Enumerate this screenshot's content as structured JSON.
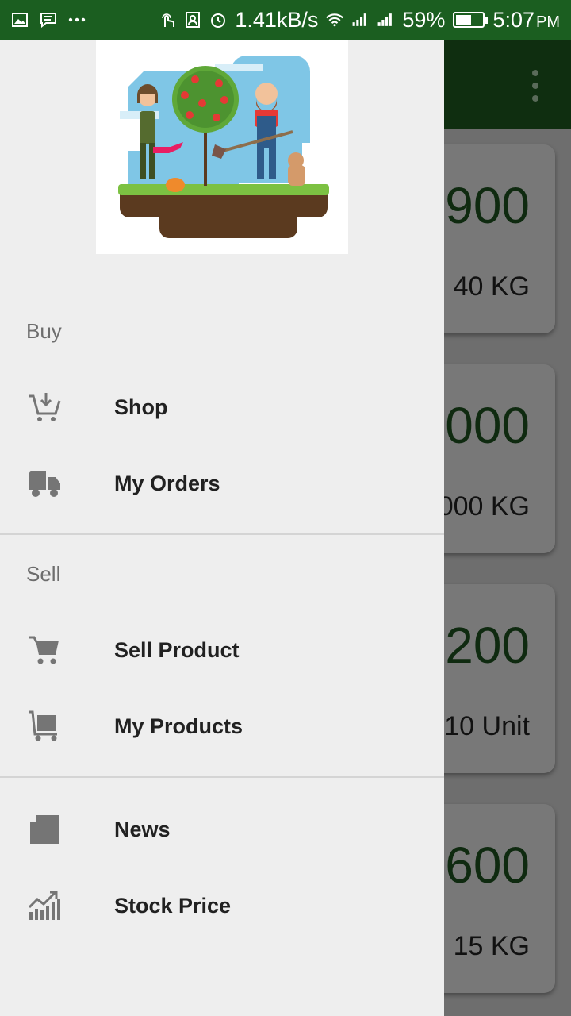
{
  "status_bar": {
    "speed": "1.41kB/s",
    "battery": "59%",
    "battery_level": 0.59,
    "time": "5:07",
    "time_suffix": "PM",
    "icons": [
      "image-icon",
      "message-icon",
      "more-icon",
      "touch-icon",
      "location-icon",
      "alarm-icon",
      "wifi-icon",
      "signal-icon",
      "battery-icon"
    ]
  },
  "drawer": {
    "header_image": "farmers-illustration",
    "sections": [
      {
        "title": "Buy",
        "items": [
          {
            "label": "Shop",
            "icon": "cart-download-icon"
          },
          {
            "label": "My Orders",
            "icon": "truck-icon"
          }
        ]
      },
      {
        "title": "Sell",
        "items": [
          {
            "label": "Sell Product",
            "icon": "cart-icon"
          },
          {
            "label": "My Products",
            "icon": "trolley-icon"
          }
        ]
      },
      {
        "title": "",
        "items": [
          {
            "label": "News",
            "icon": "news-icon"
          },
          {
            "label": "Stock Price",
            "icon": "chart-icon"
          }
        ]
      }
    ]
  },
  "background": {
    "toolbar_icon": "overflow-menu-icon",
    "cards": [
      {
        "price": "900",
        "qty": "40 KG"
      },
      {
        "price": "000",
        "qty": "000 KG"
      },
      {
        "price": "200",
        "qty": "10 Unit"
      },
      {
        "price": "600",
        "qty": "15 KG"
      }
    ]
  },
  "colors": {
    "status_bar": "#1b5e20",
    "toolbar": "#0f2e10",
    "drawer": "#eeeeee",
    "price_text": "#0f2a10"
  }
}
